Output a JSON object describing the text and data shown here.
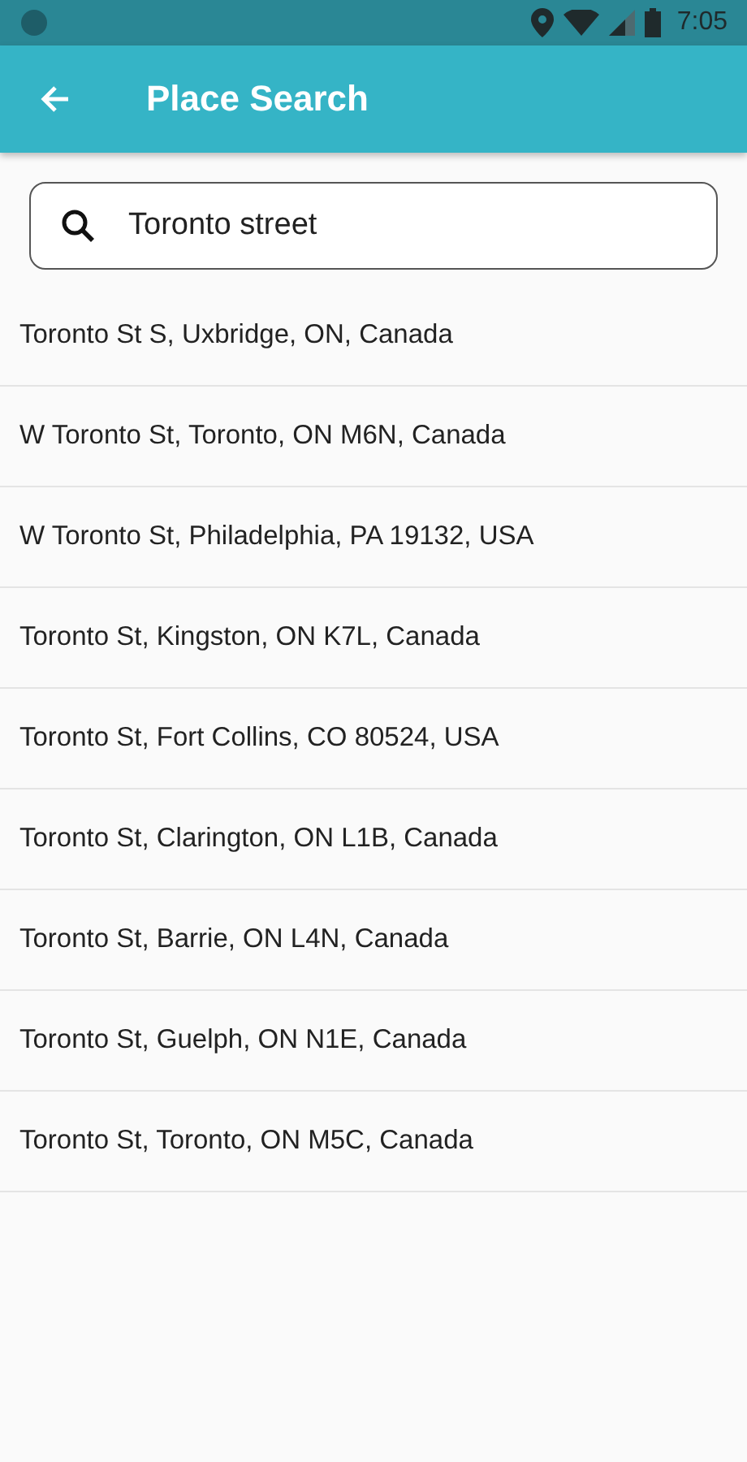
{
  "status_bar": {
    "time": "7:05"
  },
  "app_bar": {
    "title": "Place Search"
  },
  "search": {
    "value": "Toronto street"
  },
  "results": [
    {
      "text": "Toronto St S, Uxbridge, ON, Canada"
    },
    {
      "text": "W Toronto St, Toronto, ON M6N, Canada"
    },
    {
      "text": "W Toronto St, Philadelphia, PA 19132, USA"
    },
    {
      "text": "Toronto St, Kingston, ON K7L, Canada"
    },
    {
      "text": "Toronto St, Fort Collins, CO 80524, USA"
    },
    {
      "text": "Toronto St, Clarington, ON L1B, Canada"
    },
    {
      "text": "Toronto St, Barrie, ON L4N, Canada"
    },
    {
      "text": "Toronto St, Guelph, ON N1E, Canada"
    },
    {
      "text": "Toronto St, Toronto, ON M5C, Canada"
    }
  ]
}
